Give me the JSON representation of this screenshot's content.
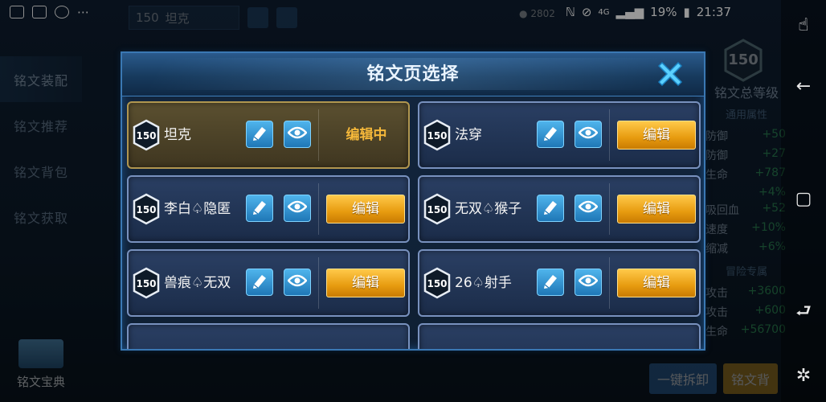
{
  "status_bar": {
    "time": "21:37",
    "battery": "19%",
    "network": "4G"
  },
  "background": {
    "hud_tab_level": "150",
    "hud_tab_name": "坦克",
    "coins": "2802",
    "side_nav": [
      "铭文装配",
      "铭文推荐",
      "铭文背包",
      "铭文获取"
    ],
    "codex_label": "铭文宝典",
    "right_panel": {
      "badge": "150",
      "title": "铭文总等级",
      "general_label": "通用属性",
      "general_rows": [
        {
          "k": "防御",
          "v": "+50"
        },
        {
          "k": "防御",
          "v": "+27"
        },
        {
          "k": "生命",
          "v": "+787"
        },
        {
          "k": "",
          "v": "+4%"
        },
        {
          "k": "吸回血",
          "v": "+52"
        },
        {
          "k": "速度",
          "v": "+10%"
        },
        {
          "k": "缩减",
          "v": "+6%"
        }
      ],
      "adventure_label": "冒险专属",
      "adventure_rows": [
        {
          "k": "攻击",
          "v": "+3600"
        },
        {
          "k": "攻击",
          "v": "+600"
        },
        {
          "k": "生命",
          "v": "+56700"
        }
      ]
    },
    "bottom_buttons": [
      "一键拆卸",
      "铭文背"
    ]
  },
  "dialog": {
    "title": "铭文页选择",
    "close_icon": "close-x-icon",
    "edit_label": "编辑",
    "editing_label": "编辑中",
    "pages": [
      {
        "level": "150",
        "name": "坦克",
        "current": true
      },
      {
        "level": "150",
        "name": "法穿",
        "current": false
      },
      {
        "level": "150",
        "name": "李白♤隐匿",
        "current": false
      },
      {
        "level": "150",
        "name": "无双♤猴子",
        "current": false
      },
      {
        "level": "150",
        "name": "兽痕♤无双",
        "current": false
      },
      {
        "level": "150",
        "name": "26♤射手",
        "current": false
      }
    ]
  },
  "colors": {
    "accent_gold": "#e79b0f",
    "accent_blue": "#1f77b7",
    "stat_green": "#3fcc6a"
  }
}
